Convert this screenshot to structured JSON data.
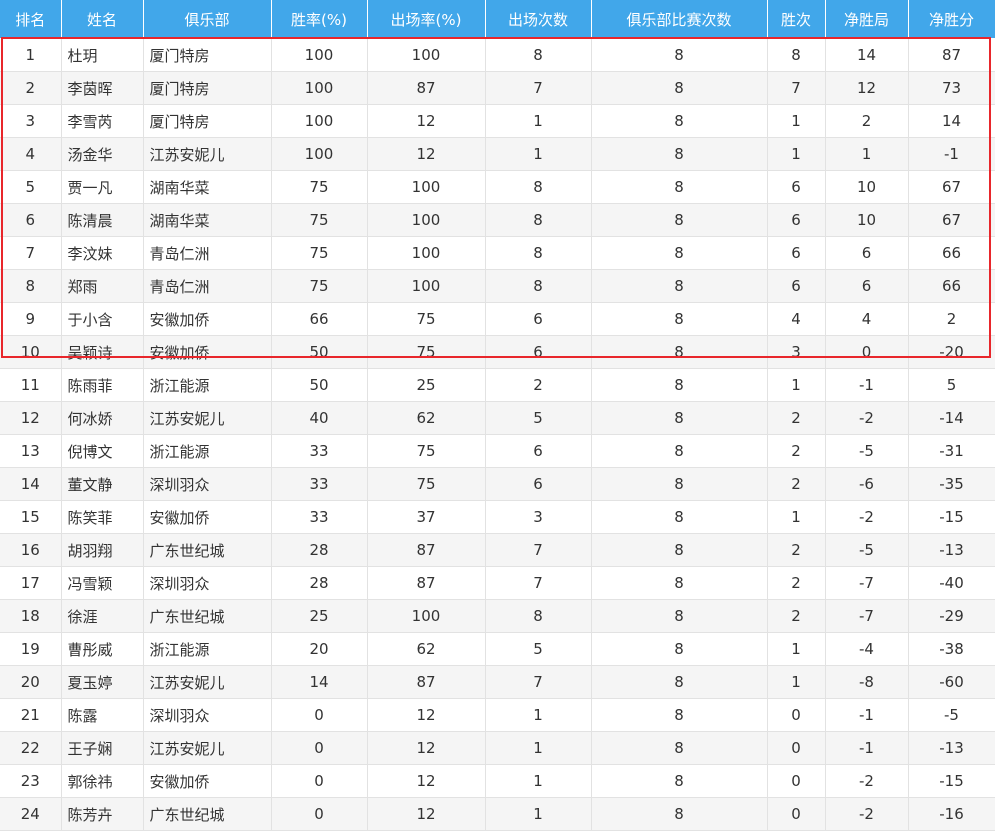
{
  "table": {
    "headers": [
      "排名",
      "姓名",
      "俱乐部",
      "胜率(%)",
      "出场率(%)",
      "出场次数",
      "俱乐部比赛次数",
      "胜次",
      "净胜局",
      "净胜分"
    ],
    "rows": [
      [
        "1",
        "杜玥",
        "厦门特房",
        "100",
        "100",
        "8",
        "8",
        "8",
        "14",
        "87"
      ],
      [
        "2",
        "李茵晖",
        "厦门特房",
        "100",
        "87",
        "7",
        "8",
        "7",
        "12",
        "73"
      ],
      [
        "3",
        "李雪芮",
        "厦门特房",
        "100",
        "12",
        "1",
        "8",
        "1",
        "2",
        "14"
      ],
      [
        "4",
        "汤金华",
        "江苏安妮儿",
        "100",
        "12",
        "1",
        "8",
        "1",
        "1",
        "-1"
      ],
      [
        "5",
        "贾一凡",
        "湖南华菜",
        "75",
        "100",
        "8",
        "8",
        "6",
        "10",
        "67"
      ],
      [
        "6",
        "陈清晨",
        "湖南华菜",
        "75",
        "100",
        "8",
        "8",
        "6",
        "10",
        "67"
      ],
      [
        "7",
        "李汶妹",
        "青岛仁洲",
        "75",
        "100",
        "8",
        "8",
        "6",
        "6",
        "66"
      ],
      [
        "8",
        "郑雨",
        "青岛仁洲",
        "75",
        "100",
        "8",
        "8",
        "6",
        "6",
        "66"
      ],
      [
        "9",
        "于小含",
        "安徽加侨",
        "66",
        "75",
        "6",
        "8",
        "4",
        "4",
        "2"
      ],
      [
        "10",
        "吴颖诗",
        "安徽加侨",
        "50",
        "75",
        "6",
        "8",
        "3",
        "0",
        "-20"
      ],
      [
        "11",
        "陈雨菲",
        "浙江能源",
        "50",
        "25",
        "2",
        "8",
        "1",
        "-1",
        "5"
      ],
      [
        "12",
        "何冰娇",
        "江苏安妮儿",
        "40",
        "62",
        "5",
        "8",
        "2",
        "-2",
        "-14"
      ],
      [
        "13",
        "倪博文",
        "浙江能源",
        "33",
        "75",
        "6",
        "8",
        "2",
        "-5",
        "-31"
      ],
      [
        "14",
        "董文静",
        "深圳羽众",
        "33",
        "75",
        "6",
        "8",
        "2",
        "-6",
        "-35"
      ],
      [
        "15",
        "陈笑菲",
        "安徽加侨",
        "33",
        "37",
        "3",
        "8",
        "1",
        "-2",
        "-15"
      ],
      [
        "16",
        "胡羽翔",
        "广东世纪城",
        "28",
        "87",
        "7",
        "8",
        "2",
        "-5",
        "-13"
      ],
      [
        "17",
        "冯雪颖",
        "深圳羽众",
        "28",
        "87",
        "7",
        "8",
        "2",
        "-7",
        "-40"
      ],
      [
        "18",
        "徐涯",
        "广东世纪城",
        "25",
        "100",
        "8",
        "8",
        "2",
        "-7",
        "-29"
      ],
      [
        "19",
        "曹彤威",
        "浙江能源",
        "20",
        "62",
        "5",
        "8",
        "1",
        "-4",
        "-38"
      ],
      [
        "20",
        "夏玉婷",
        "江苏安妮儿",
        "14",
        "87",
        "7",
        "8",
        "1",
        "-8",
        "-60"
      ],
      [
        "21",
        "陈露",
        "深圳羽众",
        "0",
        "12",
        "1",
        "8",
        "0",
        "-1",
        "-5"
      ],
      [
        "22",
        "王子娴",
        "江苏安妮儿",
        "0",
        "12",
        "1",
        "8",
        "0",
        "-1",
        "-13"
      ],
      [
        "23",
        "郭徐祎",
        "安徽加侨",
        "0",
        "12",
        "1",
        "8",
        "0",
        "-2",
        "-15"
      ],
      [
        "24",
        "陈芳卉",
        "广东世纪城",
        "0",
        "12",
        "1",
        "8",
        "0",
        "-2",
        "-16"
      ]
    ]
  },
  "colors": {
    "header_bg": "#41a7ea",
    "highlight_border": "#e8262b",
    "stripe": "#f5f5f5"
  }
}
